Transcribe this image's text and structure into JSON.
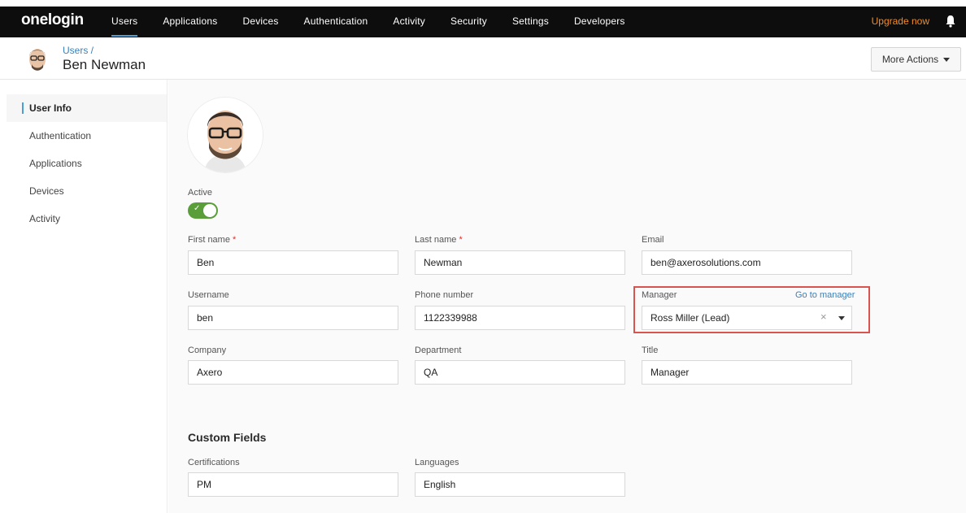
{
  "app": {
    "logo": "onelogin",
    "upgrade": "Upgrade now"
  },
  "nav": {
    "items": [
      {
        "label": "Users",
        "active": true
      },
      {
        "label": "Applications"
      },
      {
        "label": "Devices"
      },
      {
        "label": "Authentication"
      },
      {
        "label": "Activity"
      },
      {
        "label": "Security"
      },
      {
        "label": "Settings"
      },
      {
        "label": "Developers"
      }
    ]
  },
  "header": {
    "breadcrumb": "Users /",
    "title": "Ben Newman",
    "more_actions": "More Actions"
  },
  "sidebar": {
    "items": [
      {
        "label": "User Info",
        "active": true
      },
      {
        "label": "Authentication"
      },
      {
        "label": "Applications"
      },
      {
        "label": "Devices"
      },
      {
        "label": "Activity"
      }
    ]
  },
  "form": {
    "active_label": "Active",
    "active": true,
    "first_name": {
      "label": "First name",
      "required": "*",
      "value": "Ben"
    },
    "last_name": {
      "label": "Last name",
      "required": "*",
      "value": "Newman"
    },
    "email": {
      "label": "Email",
      "value": "ben@axerosolutions.com"
    },
    "username": {
      "label": "Username",
      "value": "ben"
    },
    "phone": {
      "label": "Phone number",
      "value": "1122339988"
    },
    "manager": {
      "label": "Manager",
      "link": "Go to manager",
      "value": "Ross Miller (Lead)",
      "clear": "×"
    },
    "company": {
      "label": "Company",
      "value": "Axero"
    },
    "department": {
      "label": "Department",
      "value": "QA"
    },
    "title": {
      "label": "Title",
      "value": "Manager"
    }
  },
  "custom_fields": {
    "heading": "Custom Fields",
    "certifications": {
      "label": "Certifications",
      "value": "PM"
    },
    "languages": {
      "label": "Languages",
      "value": "English"
    }
  },
  "colors": {
    "nav_bg": "#0d0d0d",
    "accent": "#4a9fd5",
    "upgrade": "#f28c28",
    "toggle_on": "#5a9e3a",
    "highlight": "#d9534f",
    "link": "#3b7fb8"
  }
}
